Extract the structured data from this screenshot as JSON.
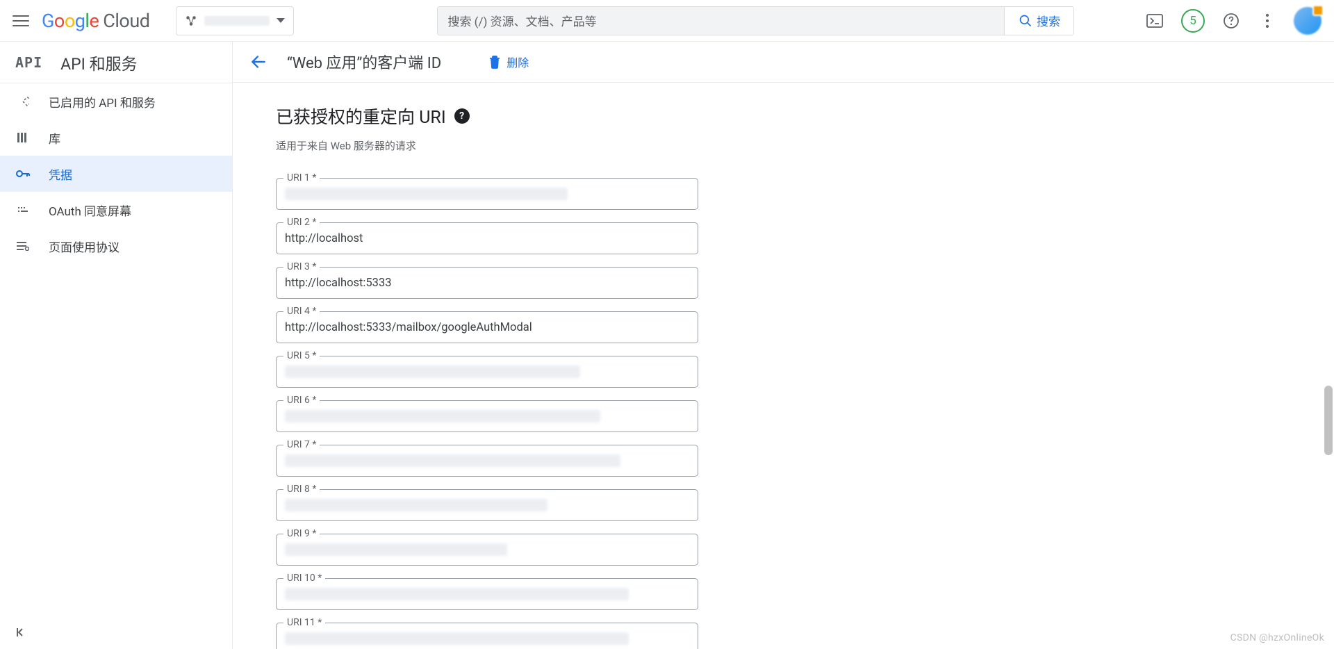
{
  "header": {
    "search_placeholder": "搜索 (/) 资源、文档、产品等",
    "search_button": "搜索",
    "cloud_label": "Cloud",
    "trial_count": "5"
  },
  "sidebar": {
    "title": "API 和服务",
    "items": [
      {
        "label": "已启用的 API 和服务"
      },
      {
        "label": "库"
      },
      {
        "label": "凭据"
      },
      {
        "label": "OAuth 同意屏幕"
      },
      {
        "label": "页面使用协议"
      }
    ]
  },
  "page": {
    "title": "“Web 应用”的客户端 ID",
    "delete": "删除"
  },
  "section": {
    "title": "已获授权的重定向 URI",
    "desc": "适用于来自 Web 服务器的请求"
  },
  "uris": [
    {
      "label": "URI 1 *",
      "value": "",
      "redacted": true,
      "w": "70%"
    },
    {
      "label": "URI 2 *",
      "value": "http://localhost"
    },
    {
      "label": "URI 3 *",
      "value": "http://localhost:5333"
    },
    {
      "label": "URI 4 *",
      "value": "http://localhost:5333/mailbox/googleAuthModal"
    },
    {
      "label": "URI 5 *",
      "value": "",
      "redacted": true,
      "w": "73%"
    },
    {
      "label": "URI 6 *",
      "value": "",
      "redacted": true,
      "w": "78%"
    },
    {
      "label": "URI 7 *",
      "value": "",
      "redacted": true,
      "w": "83%"
    },
    {
      "label": "URI 8 *",
      "value": "",
      "redacted": true,
      "w": "65%"
    },
    {
      "label": "URI 9 *",
      "value": "",
      "redacted": true,
      "w": "55%"
    },
    {
      "label": "URI 10 *",
      "value": "",
      "redacted": true,
      "w": "85%"
    },
    {
      "label": "URI 11 *",
      "value": "",
      "redacted": true,
      "w": "85%"
    }
  ],
  "watermark": "CSDN @hzxOnlineOk"
}
